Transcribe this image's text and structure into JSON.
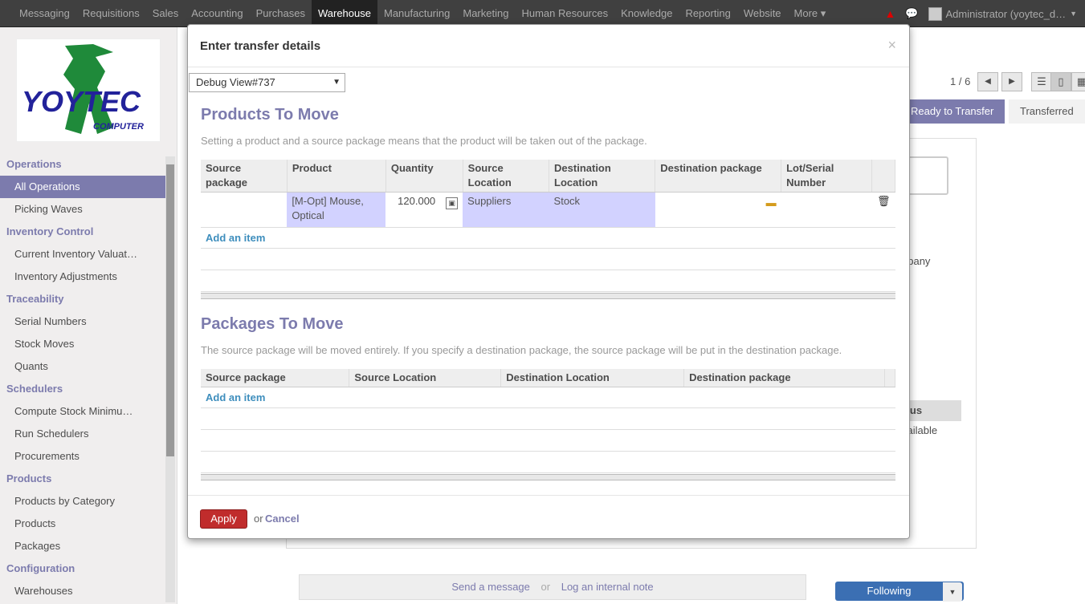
{
  "topnav": {
    "items": [
      "Messaging",
      "Requisitions",
      "Sales",
      "Accounting",
      "Purchases",
      "Warehouse",
      "Manufacturing",
      "Marketing",
      "Human Resources",
      "Knowledge",
      "Reporting",
      "Website",
      "More ▾"
    ],
    "active_index": 5,
    "user": "Administrator (yoytec_d…"
  },
  "sidebar": {
    "logo_text": "YOYTEC",
    "logo_sub": "COMPUTER",
    "sections": [
      {
        "title": "Operations",
        "items": [
          "All Operations",
          "Picking Waves"
        ]
      },
      {
        "title": "Inventory Control",
        "items": [
          "Current Inventory Valuat…",
          "Inventory Adjustments"
        ]
      },
      {
        "title": "Traceability",
        "items": [
          "Serial Numbers",
          "Stock Moves",
          "Quants"
        ]
      },
      {
        "title": "Schedulers",
        "items": [
          "Compute Stock Minimu…",
          "Run Schedulers",
          "Procurements"
        ]
      },
      {
        "title": "Products",
        "items": [
          "Products by Category",
          "Products",
          "Packages"
        ]
      },
      {
        "title": "Configuration",
        "items": [
          "Warehouses"
        ]
      }
    ],
    "selected_item": "All Operations"
  },
  "background": {
    "pager": "1 / 6",
    "status_ready": "Ready to Transfer",
    "status_transferred": "Transferred",
    "partial_company": "npany",
    "partial_status": "tatus",
    "partial_available": "vailable",
    "send_message": "Send a message",
    "or": "or",
    "log_note": "Log an internal note",
    "following": "Following"
  },
  "modal": {
    "title": "Enter transfer details",
    "close": "×",
    "debug_view": "Debug View#737",
    "products": {
      "title": "Products To Move",
      "help": "Setting a product and a source package means that the product will be taken out of the package.",
      "headers": [
        "Source package",
        "Product",
        "Quantity",
        "Source Location",
        "Destination Location",
        "Destination package",
        "Lot/Serial Number"
      ],
      "row": {
        "source_package": "",
        "product": "[M-Opt] Mouse, Optical",
        "quantity": "120.000",
        "source_location": "Suppliers",
        "destination_location": "Stock",
        "destination_package": "",
        "lot": ""
      },
      "add_item": "Add an item"
    },
    "packages": {
      "title": "Packages To Move",
      "help": "The source package will be moved entirely. If you specify a destination package, the source package will be put in the destination package.",
      "headers": [
        "Source package",
        "Source Location",
        "Destination Location",
        "Destination package"
      ],
      "add_item": "Add an item"
    },
    "footer": {
      "apply": "Apply",
      "or": "or",
      "cancel": "Cancel"
    }
  }
}
